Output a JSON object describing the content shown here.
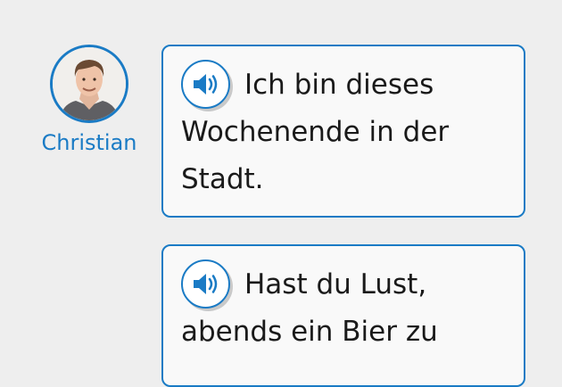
{
  "speaker": {
    "name": "Christian"
  },
  "messages": [
    {
      "lines": [
        "Ich bin dieses",
        "Wochenende in der",
        "Stadt."
      ]
    },
    {
      "lines": [
        "Hast du Lust,",
        "abends ein Bier zu"
      ]
    }
  ],
  "colors": {
    "accent": "#1a7bc5",
    "bubble_bg": "#f9f9f9",
    "page_bg": "#eeeeee"
  },
  "icons": {
    "audio": "speaker-volume-icon"
  }
}
